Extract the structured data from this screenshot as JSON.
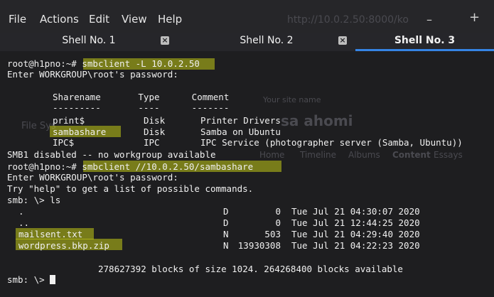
{
  "menu": [
    "File",
    "Actions",
    "Edit",
    "View",
    "Help"
  ],
  "background_window": {
    "title": "http://10.0.2.50:8000/ko",
    "heading": "sa ahomi",
    "search_hint": "Your site name",
    "nav": [
      "Home",
      "Timeline",
      "Albums",
      "Content",
      "Essays"
    ],
    "desktop_label": "File Sys"
  },
  "tabs": [
    {
      "label": "Shell No. 1",
      "close": "×"
    },
    {
      "label": "Shell No. 2",
      "close": "×"
    },
    {
      "label": "Shell No. 3"
    }
  ],
  "terminal": {
    "prompt1": "root@h1pno:~#",
    "cmd1": "smbclient -L 10.0.2.50",
    "password_prompt": "Enter WORKGROUP\\root's password:",
    "share_header": "Sharename       Type      Comment",
    "share_rule": "---------       ----      -------",
    "shares": [
      {
        "name": "print$",
        "type": "Disk",
        "comment": "Printer Drivers"
      },
      {
        "name": "sambashare",
        "type": "Disk",
        "comment": "Samba on Ubuntu"
      },
      {
        "name": "IPC$",
        "type": "IPC",
        "comment": "IPC Service (photographer server (Samba, Ubuntu))"
      }
    ],
    "smb1_msg": "SMB1 disabled -- no workgroup available",
    "prompt2": "root@h1pno:~#",
    "cmd2": "smbclient //10.0.2.50/sambashare",
    "password_prompt2": "Enter WORKGROUP\\root's password:",
    "help_msg": "Try \"help\" to get a list of possible commands.",
    "smb_ls": "smb: \\> ls",
    "files": [
      {
        "name": ".",
        "attr": "D",
        "size": "0",
        "date": "Tue Jul 21 04:30:07 2020"
      },
      {
        "name": "..",
        "attr": "D",
        "size": "0",
        "date": "Tue Jul 21 12:44:25 2020"
      },
      {
        "name": "mailsent.txt",
        "attr": "N",
        "size": "503",
        "date": "Tue Jul 21 04:29:40 2020"
      },
      {
        "name": "wordpress.bkp.zip",
        "attr": "N",
        "size": "13930308",
        "date": "Tue Jul 21 04:22:23 2020"
      }
    ],
    "blocks": "278627392 blocks of size 1024. 264268400 blocks available",
    "smb_prompt": "smb: \\>"
  }
}
